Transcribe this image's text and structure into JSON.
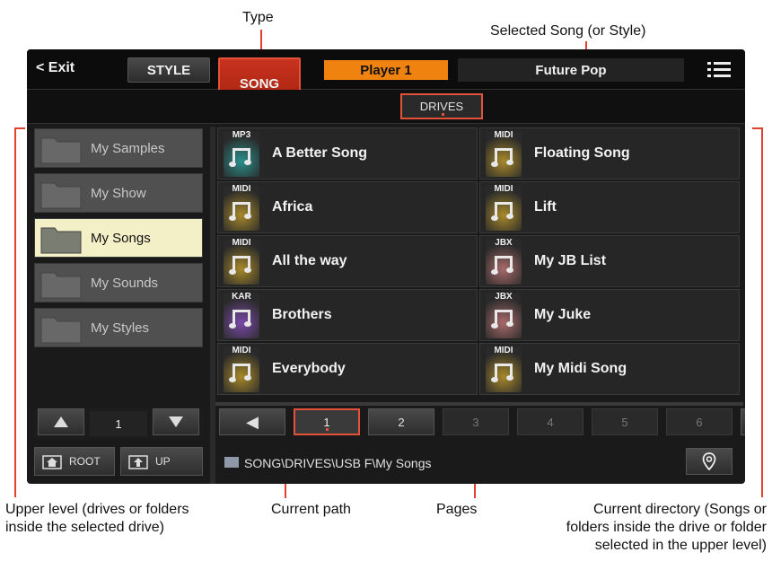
{
  "callouts": {
    "type": "Type",
    "selected_song": "Selected Song (or Style)",
    "upper_level": "Upper level (drives or folders\ninside the selected drive)",
    "current_path": "Current path",
    "pages": "Pages",
    "current_directory": "Current directory (Songs or\nfolders inside the drive or folder\nselected in the upper level)"
  },
  "topbar": {
    "exit_label": "< Exit",
    "style_label": "STYLE",
    "song_label": "SONG",
    "player_label": "Player 1",
    "song_name": "Future Pop"
  },
  "tabs": {
    "drives_label": "DRIVES"
  },
  "folders": [
    {
      "label": "My Samples",
      "selected": false
    },
    {
      "label": "My Show",
      "selected": false
    },
    {
      "label": "My Songs",
      "selected": true
    },
    {
      "label": "My Sounds",
      "selected": false
    },
    {
      "label": "My Styles",
      "selected": false
    }
  ],
  "folder_nav": {
    "page": "1",
    "root_label": "ROOT",
    "up_label": "UP"
  },
  "songs": [
    {
      "type": "MP3",
      "label": "A Better Song"
    },
    {
      "type": "MIDI",
      "label": "Floating Song"
    },
    {
      "type": "MIDI",
      "label": "Africa"
    },
    {
      "type": "MIDI",
      "label": "Lift"
    },
    {
      "type": "MIDI",
      "label": "All the way"
    },
    {
      "type": "JBX",
      "label": "My JB List"
    },
    {
      "type": "KAR",
      "label": "Brothers"
    },
    {
      "type": "JBX",
      "label": "My Juke"
    },
    {
      "type": "MIDI",
      "label": "Everybody"
    },
    {
      "type": "MIDI",
      "label": "My Midi Song"
    }
  ],
  "badge_colors": {
    "MP3": "#2a8f8a",
    "MIDI": "#a8892a",
    "JBX": "#a86a6a",
    "KAR": "#7a4aa8"
  },
  "pages": [
    "1",
    "2",
    "3",
    "4",
    "5",
    "6"
  ],
  "current_page": "1",
  "path": "SONG\\DRIVES\\USB F\\My Songs",
  "colors": {
    "accent": "#e4523a",
    "player": "#f0820f",
    "selected_folder": "#f3f0c8"
  }
}
